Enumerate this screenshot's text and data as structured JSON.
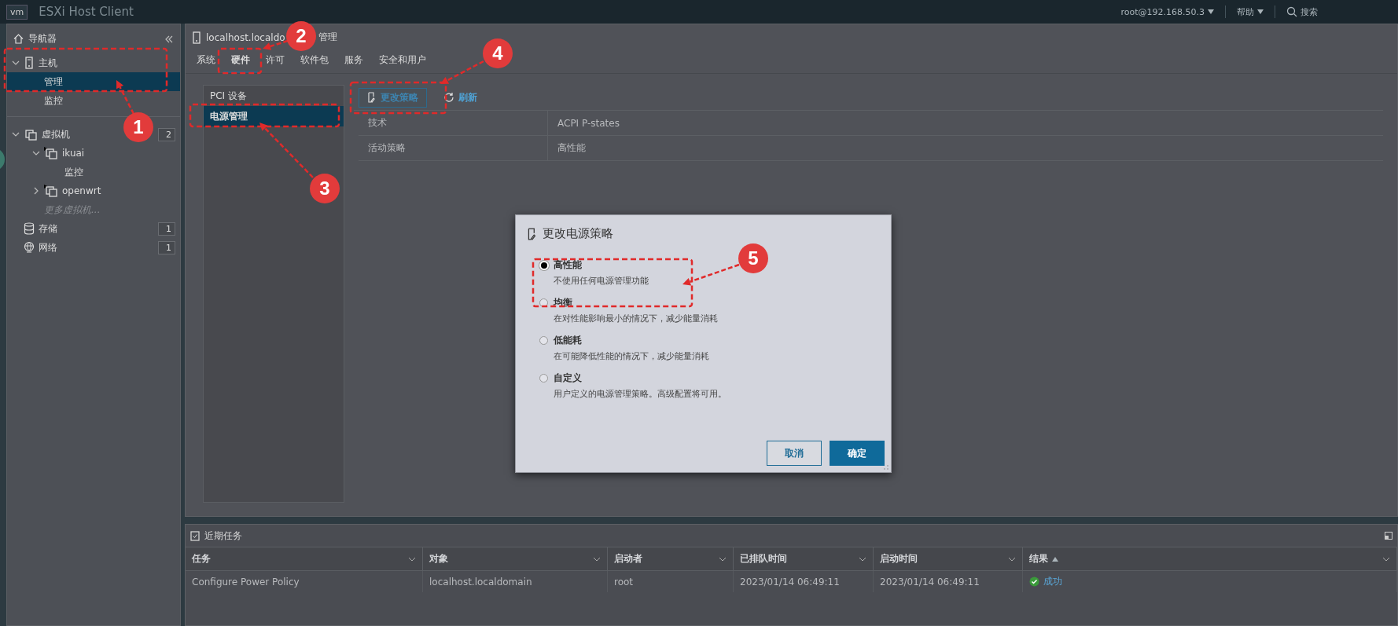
{
  "topbar": {
    "logo": "vm",
    "title": "ESXi Host Client",
    "user": "root@192.168.50.3",
    "help": "帮助",
    "search": "搜索"
  },
  "navigator": {
    "title": "导航器",
    "items": [
      {
        "label": "主机",
        "kind": "host",
        "expanded": true,
        "selected": false,
        "children": [
          {
            "label": "管理",
            "selected": true
          },
          {
            "label": "监控",
            "selected": false
          }
        ]
      },
      {
        "label": "虚拟机",
        "kind": "vm",
        "expanded": true,
        "selected": false,
        "count": "2",
        "children": [
          {
            "label": "ikuai",
            "kind": "vm",
            "powered_on": true,
            "expanded": true,
            "selected": false,
            "children": [
              {
                "label": "监控",
                "selected": false
              }
            ]
          },
          {
            "label": "openwrt",
            "kind": "vm",
            "powered_on": true,
            "expanded": false,
            "selected": false
          },
          {
            "label": "更多虚拟机...",
            "kind": "more",
            "selected": false
          }
        ]
      },
      {
        "label": "存储",
        "kind": "storage",
        "selected": false,
        "count": "1"
      },
      {
        "label": "网络",
        "kind": "network",
        "selected": false,
        "count": "1"
      }
    ]
  },
  "host_header": {
    "title_start": "localhost.localdo",
    "title_end": "管理"
  },
  "tabs": [
    {
      "label": "系统",
      "selected": false
    },
    {
      "label": "硬件",
      "selected": true
    },
    {
      "label": "许可",
      "selected": false
    },
    {
      "label": "软件包",
      "selected": false
    },
    {
      "label": "服务",
      "selected": false
    },
    {
      "label": "安全和用户",
      "selected": false
    }
  ],
  "hardware_menu": [
    {
      "label": "PCI 设备",
      "selected": false
    },
    {
      "label": "电源管理",
      "selected": true
    }
  ],
  "toolbar": [
    {
      "label": "更改策略",
      "kind": "edit"
    },
    {
      "label": "刷新",
      "kind": "refresh"
    }
  ],
  "properties": [
    {
      "name": "技术",
      "value": "ACPI P-states"
    },
    {
      "name": "活动策略",
      "value": "高性能"
    }
  ],
  "dialog": {
    "title": "更改电源策略",
    "options": [
      {
        "label": "高性能",
        "description": "不使用任何电源管理功能",
        "selected": true
      },
      {
        "label": "均衡",
        "description": "在对性能影响最小的情况下，减少能量消耗",
        "selected": false
      },
      {
        "label": "低能耗",
        "description": "在可能降低性能的情况下，减少能量消耗",
        "selected": false
      },
      {
        "label": "自定义",
        "description": "用户定义的电源管理策略。高级配置将可用。",
        "selected": false
      }
    ],
    "buttons": [
      {
        "label": "取消",
        "kind": "secondary"
      },
      {
        "label": "确定",
        "kind": "primary"
      }
    ]
  },
  "tasks": {
    "title": "近期任务",
    "columns": [
      {
        "label": "任务",
        "sorted": false
      },
      {
        "label": "对象",
        "sorted": false
      },
      {
        "label": "启动者",
        "sorted": false
      },
      {
        "label": "已排队时间",
        "sorted": false
      },
      {
        "label": "启动时间",
        "sorted": false
      },
      {
        "label": "结果",
        "sorted": true
      }
    ],
    "rows": [
      {
        "cells": [
          "Configure Power Policy",
          "localhost.localdomain",
          "root",
          "2023/01/14 06:49:11",
          "2023/01/14 06:49:11",
          "成功"
        ],
        "kind": "success"
      }
    ]
  },
  "annotations": [
    {
      "number": "1"
    },
    {
      "number": "2"
    },
    {
      "number": "3"
    },
    {
      "number": "4"
    },
    {
      "number": "5"
    }
  ]
}
